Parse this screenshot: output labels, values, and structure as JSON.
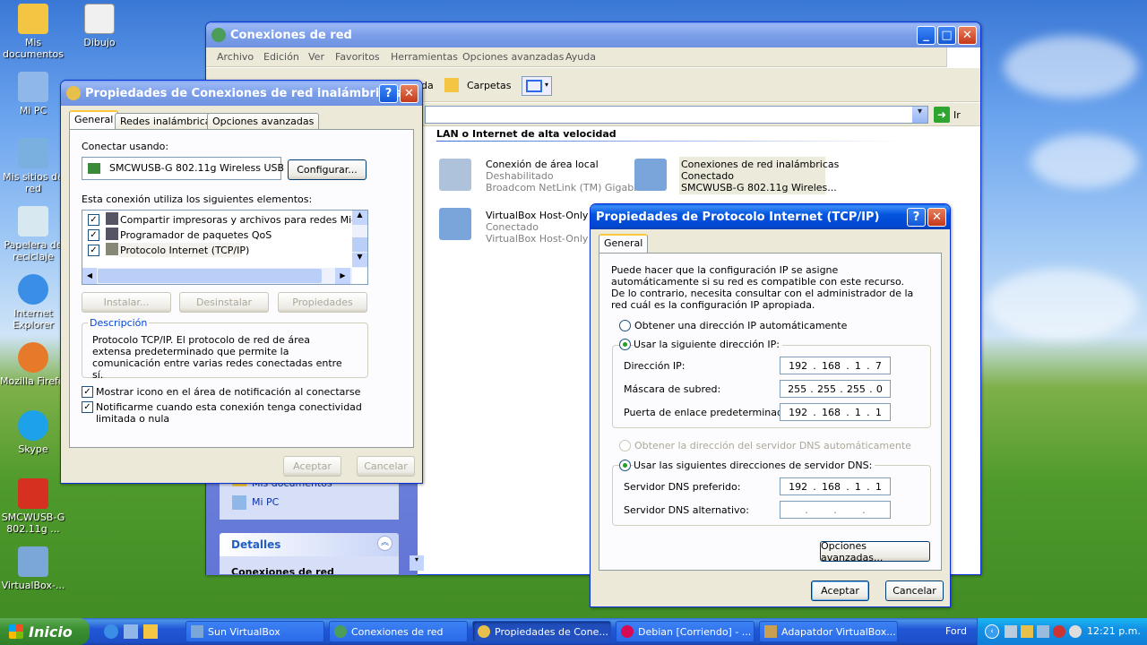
{
  "desktop_icons": [
    {
      "label": "Mis documentos",
      "color": "#f4c542"
    },
    {
      "label": "Dibujo",
      "color": "#f0f0f0"
    },
    {
      "label": "Mi PC",
      "color": "#8fb8e8"
    },
    {
      "label": "Mis sitios de red",
      "color": "#7ab0e0"
    },
    {
      "label": "Papelera de reciclaje",
      "color": "#d8e8f0"
    },
    {
      "label": "Internet Explorer",
      "color": "#3a8ee6"
    },
    {
      "label": "Mozilla Firefox",
      "color": "#e77a2a"
    },
    {
      "label": "Skype",
      "color": "#1da1e8"
    },
    {
      "label": "SMCWUSB-G 802.11g ...",
      "color": "#d63020"
    },
    {
      "label": "VirtualBox-...",
      "color": "#7ba7d8"
    }
  ],
  "explorer": {
    "title": "Conexiones de red",
    "menu": [
      "Archivo",
      "Edición",
      "Ver",
      "Favoritos",
      "Herramientas",
      "Opciones avanzadas",
      "Ayuda"
    ],
    "toolbar_partial": "da",
    "toolbar_folders": "Carpetas",
    "go_label": "Ir",
    "group_header": "LAN o Internet de alta velocidad",
    "connections": [
      {
        "name": "Conexión de área local",
        "status": "Deshabilitado",
        "device": "Broadcom NetLink (TM) Gigabit..."
      },
      {
        "name": "Conexiones de red inalámbricas",
        "status": "Conectado",
        "device": "SMCWUSB-G 802.11g Wireles..."
      },
      {
        "name": "VirtualBox Host-Only Ne",
        "status": "Conectado",
        "device": "VirtualBox Host-Only Eth"
      }
    ],
    "sidebar_links": [
      "Mis documentos",
      "Mi PC"
    ],
    "details_title": "Detalles",
    "details_partial": "Conexiones de red"
  },
  "wireless_dialog": {
    "title": "Propiedades de Conexiones de red inalámbricas",
    "tabs": [
      "General",
      "Redes inalámbricas",
      "Opciones avanzadas"
    ],
    "connect_using_label": "Conectar usando:",
    "adapter": "SMCWUSB-G 802.11g Wireless USB",
    "configure_button": "Configurar...",
    "elements_label": "Esta conexión utiliza los siguientes elementos:",
    "elements": [
      "Compartir impresoras y archivos para redes Microsoft",
      "Programador de paquetes QoS",
      "Protocolo Internet (TCP/IP)"
    ],
    "install_button": "Instalar...",
    "uninstall_button": "Desinstalar",
    "properties_button": "Propiedades",
    "description_title": "Descripción",
    "description_text": "Protocolo TCP/IP. El protocolo de red de área extensa predeterminado que permite la comunicación entre varias redes conectadas entre sí.",
    "check1": "Mostrar icono en el área de notificación al conectarse",
    "check2": "Notificarme cuando esta conexión tenga conectividad limitada o nula",
    "ok_button": "Aceptar",
    "cancel_button": "Cancelar"
  },
  "tcpip_dialog": {
    "title": "Propiedades de Protocolo Internet (TCP/IP)",
    "tab": "General",
    "intro": "Puede hacer que la configuración IP se asigne automáticamente si su red es compatible con este recurso. De lo contrario, necesita consultar con el administrador de la red cuál es la configuración IP apropiada.",
    "auto_ip": "Obtener una dirección IP automáticamente",
    "manual_ip": "Usar la siguiente dirección IP:",
    "ip_label": "Dirección IP:",
    "ip": [
      "192",
      "168",
      "1",
      "7"
    ],
    "mask_label": "Máscara de subred:",
    "mask": [
      "255",
      "255",
      "255",
      "0"
    ],
    "gateway_label": "Puerta de enlace predeterminada:",
    "gateway": [
      "192",
      "168",
      "1",
      "1"
    ],
    "auto_dns": "Obtener la dirección del servidor DNS automáticamente",
    "manual_dns": "Usar las siguientes direcciones de servidor DNS:",
    "dns1_label": "Servidor DNS preferido:",
    "dns1": [
      "192",
      "168",
      "1",
      "1"
    ],
    "dns2_label": "Servidor DNS alternativo:",
    "advanced_button": "Opciones avanzadas...",
    "ok_button": "Aceptar",
    "cancel_button": "Cancelar"
  },
  "taskbar": {
    "start": "Inicio",
    "tasks": [
      "Sun VirtualBox",
      "Conexiones de red",
      "Propiedades de Cone...",
      "Debian [Corriendo] - ...",
      "Adapatdor VirtualBox..."
    ],
    "tray_text": "Ford",
    "clock": "12:21 p.m."
  }
}
